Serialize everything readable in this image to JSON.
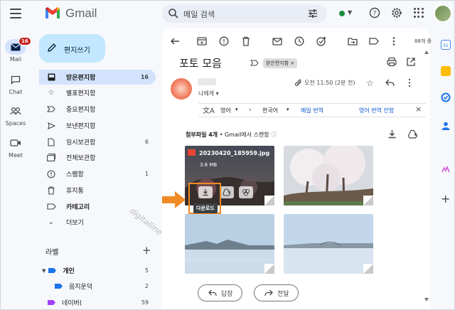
{
  "header": {
    "logo_text": "Gmail",
    "search_placeholder": "메일 검색"
  },
  "rail": {
    "items": [
      {
        "label": "Mail",
        "badge": "16"
      },
      {
        "label": "Chat"
      },
      {
        "label": "Spaces"
      },
      {
        "label": "Meet"
      }
    ]
  },
  "sidebar": {
    "compose_label": "편지쓰기",
    "items": [
      {
        "label": "받은편지함",
        "count": "16",
        "icon": "inbox-icon"
      },
      {
        "label": "별표편지함",
        "count": "",
        "icon": "star-icon"
      },
      {
        "label": "중요편지함",
        "count": "",
        "icon": "important-icon"
      },
      {
        "label": "보낸편지함",
        "count": "",
        "icon": "send-icon"
      },
      {
        "label": "임시보관함",
        "count": "6",
        "icon": "draft-icon"
      },
      {
        "label": "전체보관함",
        "count": "",
        "icon": "all-mail-icon"
      },
      {
        "label": "스팸함",
        "count": "1",
        "icon": "spam-icon"
      },
      {
        "label": "휴지통",
        "count": "",
        "icon": "trash-icon"
      },
      {
        "label": "카테고리",
        "count": "",
        "icon": "label-icon"
      },
      {
        "label": "더보기",
        "count": "",
        "icon": "chevron-down-icon"
      }
    ],
    "labels_title": "라벨",
    "labels": [
      {
        "label": "개인",
        "count": "5",
        "color": "#1a73e8"
      },
      {
        "label": "음지운덕",
        "count": "2",
        "color": "#1a73e8"
      },
      {
        "label": "네이버(",
        "count": "59",
        "color": "#a142f4"
      }
    ]
  },
  "toolbar": {
    "page_count": "88개 중"
  },
  "message": {
    "subject": "포토 모음",
    "label_chip": "받은편지함 ×",
    "time": "오전 11:50 (2분 전)",
    "to_me": "나에게 ▾",
    "translate": {
      "from": "영어",
      "to": "한국어",
      "translate_link": "메일 번역",
      "disable_link": "영어 번역 안함"
    },
    "attachments_title_bold": "첨부파일 4개",
    "attachments_title_rest": " • Gmail에서 스캔함",
    "first_file_name": "20230420_185959.jpg",
    "first_file_size": "3.6 MB",
    "download_tooltip": "다운로드",
    "reply_label": "답장",
    "forward_label": "전달"
  },
  "watermark": "digitalline",
  "colors": {
    "accent": "#0b57d0",
    "highlight": "#f08a24",
    "compose_bg": "#c2e7ff",
    "active_nav": "#d3e3fd"
  }
}
